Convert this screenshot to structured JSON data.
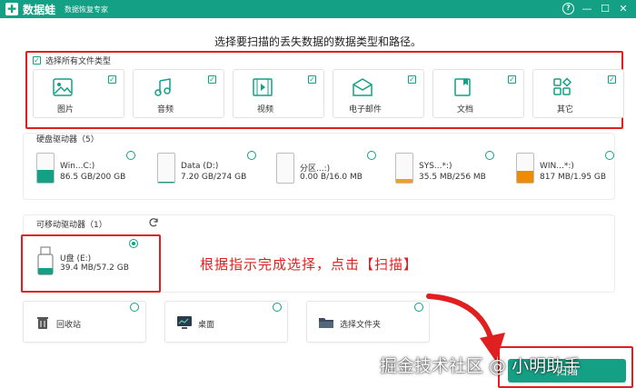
{
  "app": {
    "logo_glyph": "✚",
    "name": "数据蛙",
    "subtitle": "数据恢复专家",
    "accent": "#14a085"
  },
  "window_controls": [
    {
      "name": "help-icon",
      "glyph": "?"
    },
    {
      "name": "minimize-icon",
      "glyph": "—"
    },
    {
      "name": "maximize-icon",
      "glyph": "☐"
    },
    {
      "name": "close-icon",
      "glyph": "✕"
    }
  ],
  "heading": "选择要扫描的丢失数据的数据类型和路径。",
  "file_types": {
    "select_all_label": "选择所有文件类型",
    "select_all_checked": true,
    "items": [
      {
        "label": "图片",
        "icon": "image-icon",
        "checked": true
      },
      {
        "label": "音频",
        "icon": "audio-icon",
        "checked": true
      },
      {
        "label": "视频",
        "icon": "video-icon",
        "checked": true
      },
      {
        "label": "电子邮件",
        "icon": "email-icon",
        "checked": true
      },
      {
        "label": "文档",
        "icon": "document-icon",
        "checked": true
      },
      {
        "label": "其它",
        "icon": "other-icon",
        "checked": true
      }
    ]
  },
  "hard_drives": {
    "title": "硬盘驱动器（5）",
    "items": [
      {
        "name": "Win...C:)",
        "size": "86.5 GB/200 GB",
        "used_fraction": 0.43,
        "fill_color": "#14a085",
        "selected": false
      },
      {
        "name": "Data (D:)",
        "size": "7.20 GB/274 GB",
        "used_fraction": 0.03,
        "fill_color": "#14a085",
        "selected": false
      },
      {
        "name": "分区...:)",
        "size": "0.00 B/16.0 MB",
        "used_fraction": 0.0,
        "fill_color": "#14a085",
        "selected": false
      },
      {
        "name": "SYS...*:)",
        "size": "35.5 MB/256 MB",
        "used_fraction": 0.14,
        "fill_color": "#f0a020",
        "selected": false
      },
      {
        "name": "WIN...*:)",
        "size": "817 MB/1.95 GB",
        "used_fraction": 0.42,
        "fill_color": "#f08a00",
        "selected": false
      }
    ]
  },
  "removable": {
    "title": "可移动驱动器（1）",
    "refresh_icon": "refresh-icon",
    "items": [
      {
        "name": "U盘 (E:)",
        "size": "39.4 MB/57.2 GB",
        "used_fraction": 0.01,
        "selected": true
      }
    ]
  },
  "instruction": "根据指示完成选择，点击【扫描】",
  "locations": [
    {
      "label": "回收站",
      "icon": "recycle-bin-icon"
    },
    {
      "label": "桌面",
      "icon": "desktop-icon"
    },
    {
      "label": "选择文件夹",
      "icon": "folder-icon"
    }
  ],
  "watermark": "掘金技术社区 @ 小明助手",
  "scan_button": "扫描"
}
